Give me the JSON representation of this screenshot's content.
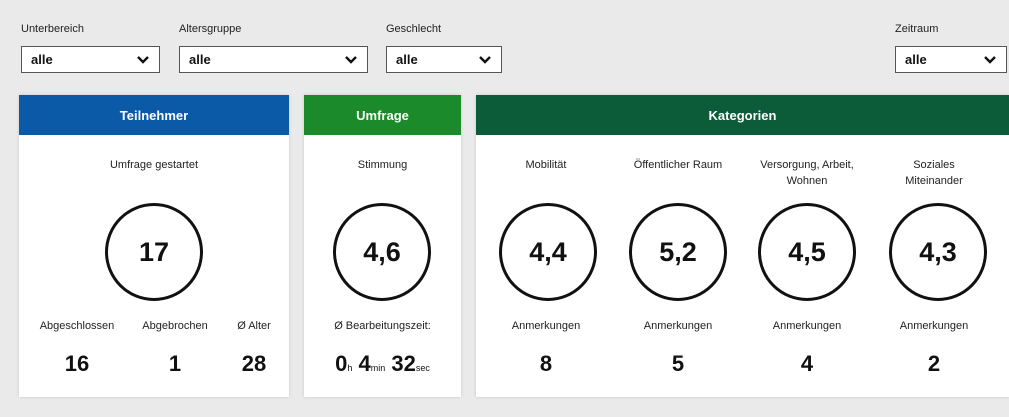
{
  "filters": {
    "unterbereich": {
      "label": "Unterbereich",
      "value": "alle"
    },
    "altersgruppe": {
      "label": "Altersgruppe",
      "value": "alle"
    },
    "geschlecht": {
      "label": "Geschlecht",
      "value": "alle"
    },
    "zeitraum": {
      "label": "Zeitraum",
      "value": "alle"
    }
  },
  "colors": {
    "teilnehmer": "#0a5aa8",
    "umfrage": "#1a8a2a",
    "kategorien": "#0c5c3a"
  },
  "teilnehmer": {
    "title": "Teilnehmer",
    "subtitle": "Umfrage gestartet",
    "total": "17",
    "stats": [
      {
        "label": "Abgeschlossen",
        "value": "16"
      },
      {
        "label": "Abgebrochen",
        "value": "1"
      },
      {
        "label": "Ø Alter",
        "value": "28"
      }
    ]
  },
  "umfrage": {
    "title": "Umfrage",
    "subtitle": "Stimmung",
    "value": "4,6",
    "time_label": "Ø Bearbeitungszeit:",
    "hours": "0",
    "hours_unit": "h",
    "minutes": "4",
    "minutes_unit": "min",
    "seconds": "32",
    "seconds_unit": "sec"
  },
  "kategorien": {
    "title": "Kategorien",
    "items": [
      {
        "name": "Mobilität",
        "value": "4,4",
        "notes_label": "Anmerkungen",
        "notes": "8"
      },
      {
        "name": "Öffentlicher Raum",
        "value": "5,2",
        "notes_label": "Anmerkungen",
        "notes": "5"
      },
      {
        "name": "Versorgung, Arbeit, Wohnen",
        "value": "4,5",
        "notes_label": "Anmerkungen",
        "notes": "4"
      },
      {
        "name": "Soziales Miteinander",
        "value": "4,3",
        "notes_label": "Anmerkungen",
        "notes": "2"
      }
    ]
  }
}
